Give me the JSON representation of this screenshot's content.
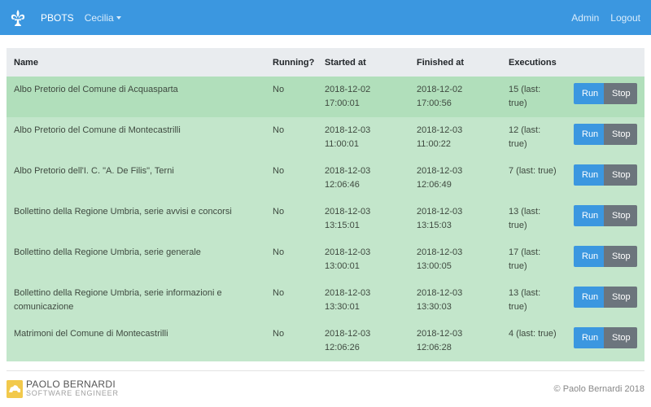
{
  "navbar": {
    "brand": "PBOTS",
    "user": "Cecilia",
    "admin": "Admin",
    "logout": "Logout",
    "logo_icon": "fleur-de-lis-icon"
  },
  "table": {
    "headers": [
      "Name",
      "Running?",
      "Started at",
      "Finished at",
      "Executions"
    ],
    "rows": [
      {
        "name": "Albo Pretorio del Comune di Acquasparta",
        "running": "No",
        "started_date": "2018-12-02",
        "started_time": "17:00:01",
        "finished_date": "2018-12-02",
        "finished_time": "17:00:56",
        "exec1": "15 (last:",
        "exec2": "true)"
      },
      {
        "name": "Albo Pretorio del Comune di Montecastrilli",
        "running": "No",
        "started_date": "2018-12-03",
        "started_time": "11:00:01",
        "finished_date": "2018-12-03",
        "finished_time": "11:00:22",
        "exec1": "12 (last:",
        "exec2": "true)"
      },
      {
        "name": "Albo Pretorio dell'I. C. \"A. De Filis\", Terni",
        "running": "No",
        "started_date": "2018-12-03",
        "started_time": "12:06:46",
        "finished_date": "2018-12-03",
        "finished_time": "12:06:49",
        "exec1": "7 (last: true)",
        "exec2": ""
      },
      {
        "name": "Bollettino della Regione Umbria, serie avvisi e concorsi",
        "running": "No",
        "started_date": "2018-12-03",
        "started_time": "13:15:01",
        "finished_date": "2018-12-03",
        "finished_time": "13:15:03",
        "exec1": "13 (last:",
        "exec2": "true)"
      },
      {
        "name": "Bollettino della Regione Umbria, serie generale",
        "running": "No",
        "started_date": "2018-12-03",
        "started_time": "13:00:01",
        "finished_date": "2018-12-03",
        "finished_time": "13:00:05",
        "exec1": "17 (last:",
        "exec2": "true)"
      },
      {
        "name": "Bollettino della Regione Umbria, serie informazioni e comunicazione",
        "running": "No",
        "started_date": "2018-12-03",
        "started_time": "13:30:01",
        "finished_date": "2018-12-03",
        "finished_time": "13:30:03",
        "exec1": "13 (last:",
        "exec2": "true)"
      },
      {
        "name": "Matrimoni del Comune di Montecastrilli",
        "running": "No",
        "started_date": "2018-12-03",
        "started_time": "12:06:26",
        "finished_date": "2018-12-03",
        "finished_time": "12:06:28",
        "exec1": "4 (last: true)",
        "exec2": ""
      }
    ],
    "run_label": "Run",
    "stop_label": "Stop"
  },
  "footer": {
    "logo_name": "PAOLO BERNARDI",
    "logo_sub": "SOFTWARE ENGINEER",
    "copyright": "© Paolo Bernardi  2018"
  },
  "colors": {
    "navbar": "#3b97e0",
    "row_success": "#c3e6cb",
    "row_success_active": "#b1dfbb",
    "run_button": "#3b97e0",
    "stop_button": "#6c757d"
  }
}
